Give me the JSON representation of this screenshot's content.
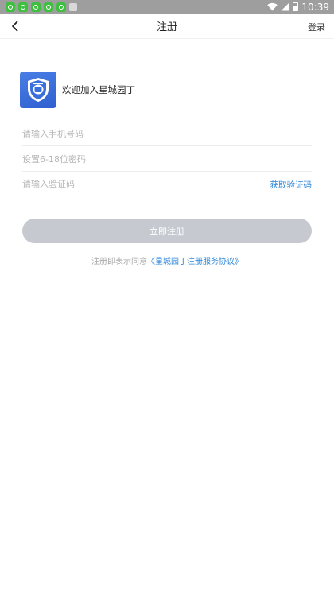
{
  "status_bar": {
    "time": "10:39",
    "notification_icons": [
      "app-notification-icon",
      "app-notification-icon",
      "app-notification-icon",
      "app-notification-icon",
      "app-notification-icon",
      "a-notification-icon"
    ]
  },
  "nav": {
    "title": "注册",
    "login": "登录"
  },
  "brand": {
    "welcome": "欢迎加入星城园丁"
  },
  "form": {
    "phone_placeholder": "请输入手机号码",
    "password_placeholder": "设置6-18位密码",
    "code_placeholder": "请输入验证码",
    "get_code": "获取验证码",
    "submit": "立即注册"
  },
  "agreement": {
    "prefix": "注册即表示同意",
    "link": "《星城园丁注册服务协议》"
  },
  "colors": {
    "accent": "#2b86d9",
    "button_disabled": "#c6c9cf",
    "logo": "#3a6fdc"
  }
}
